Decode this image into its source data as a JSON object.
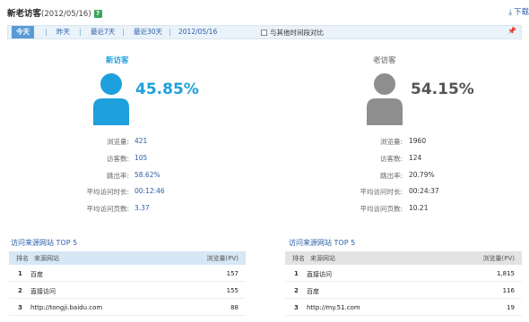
{
  "header": {
    "title": "新老访客",
    "date": "(2012/05/16)",
    "help_label": "?",
    "download_label": "下载"
  },
  "toolbar": {
    "tabs": [
      "今天",
      "昨天",
      "最近7天",
      "最近30天",
      "2012/05/16"
    ],
    "compare_label": "与其他时间段对比"
  },
  "new_visitor": {
    "title": "新访客",
    "percent": "45.85%",
    "color": "#1ea0dc",
    "stats": [
      {
        "label": "浏览量:",
        "value": "421"
      },
      {
        "label": "访客数:",
        "value": "105"
      },
      {
        "label": "跳出率:",
        "value": "58.62%"
      },
      {
        "label": "平均访问时长:",
        "value": "00:12:46"
      },
      {
        "label": "平均访问页数:",
        "value": "3.37"
      }
    ]
  },
  "old_visitor": {
    "title": "老访客",
    "percent": "54.15%",
    "color": "#8e8e8e",
    "stats": [
      {
        "label": "浏览量:",
        "value": "1960"
      },
      {
        "label": "访客数:",
        "value": "124"
      },
      {
        "label": "跳出率:",
        "value": "20.79%"
      },
      {
        "label": "平均访问时长:",
        "value": "00:24:37"
      },
      {
        "label": "平均访问页数:",
        "value": "10.21"
      }
    ]
  },
  "new_sources": {
    "title": "访问来源网站",
    "top": "TOP 5",
    "columns": [
      "排名",
      "来源网站",
      "浏览量(PV)"
    ],
    "rows": [
      {
        "rank": "1",
        "site": "百度",
        "pv": "157"
      },
      {
        "rank": "2",
        "site": "直接访问",
        "pv": "155"
      },
      {
        "rank": "3",
        "site": "http://tongji.baidu.com",
        "pv": "88"
      }
    ]
  },
  "old_sources": {
    "title": "访问来源网站",
    "top": "TOP 5",
    "columns": [
      "排名",
      "来源网站",
      "浏览量(PV)"
    ],
    "rows": [
      {
        "rank": "1",
        "site": "直接访问",
        "pv": "1,815"
      },
      {
        "rank": "2",
        "site": "百度",
        "pv": "116"
      },
      {
        "rank": "3",
        "site": "http://my.51.com",
        "pv": "19"
      }
    ]
  },
  "colors": {
    "blue": "#1ea0dc",
    "gray": "#8e8e8e",
    "link": "#2b5ea8",
    "header_blue": "#d6e7f5",
    "header_gray": "#e3e3e3"
  }
}
